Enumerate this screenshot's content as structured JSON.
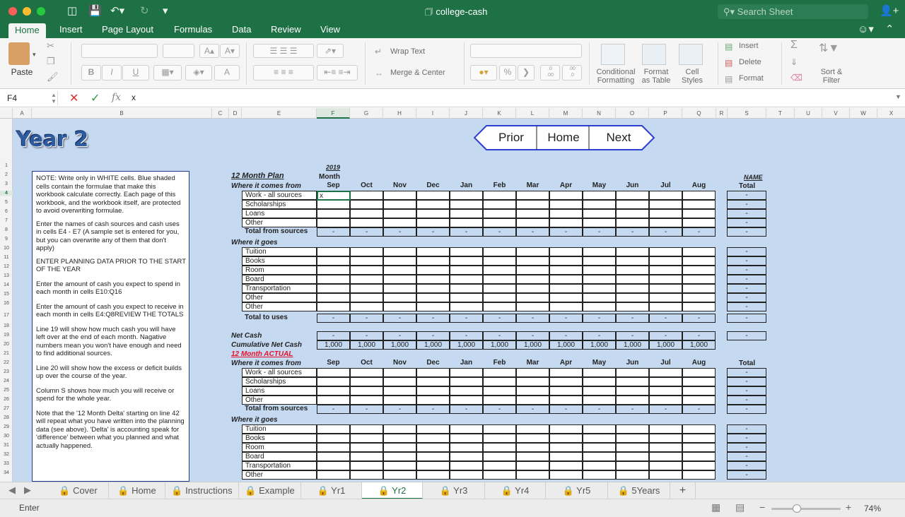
{
  "window": {
    "title": "college-cash",
    "search_placeholder": "Search Sheet"
  },
  "ribbon_tabs": [
    "Home",
    "Insert",
    "Page Layout",
    "Formulas",
    "Data",
    "Review",
    "View"
  ],
  "ribbon": {
    "paste": "Paste",
    "wrap_text": "Wrap Text",
    "merge_center": "Merge & Center",
    "percent": "%",
    "comma": "❯",
    "dec_inc": ".0\n.00",
    "dec_dec": ".00\n→.0",
    "conditional_formatting": "Conditional\nFormatting",
    "format_as_table": "Format\nas Table",
    "cell_styles": "Cell\nStyles",
    "insert": "Insert",
    "delete": "Delete",
    "format": "Format",
    "sort_filter": "Sort &\nFilter",
    "bold": "B",
    "italic": "I",
    "underline": "U",
    "grow_font": "A▴",
    "shrink_font": "A▾",
    "font_color": "A"
  },
  "formula_bar": {
    "name_box": "F4",
    "fx": "fx",
    "value": "x"
  },
  "columns": [
    "A",
    "B",
    "C",
    "D",
    "E",
    "F",
    "G",
    "H",
    "I",
    "J",
    "K",
    "L",
    "M",
    "N",
    "O",
    "P",
    "Q",
    "R",
    "S",
    "T",
    "U",
    "V",
    "W",
    "X"
  ],
  "rows": [
    "1",
    "2",
    "3",
    "4",
    "5",
    "6",
    "7",
    "8",
    "9",
    "10",
    "11",
    "12",
    "13",
    "14",
    "15",
    "16",
    "17",
    "18",
    "19",
    "20",
    "21",
    "22",
    "23",
    "24",
    "25",
    "26",
    "27",
    "28",
    "29",
    "30",
    "31",
    "32",
    "33",
    "34"
  ],
  "sheet": {
    "heading": "Year 2",
    "nav": {
      "prior": "Prior",
      "home": "Home",
      "next": "Next"
    },
    "notes": [
      "NOTE: Write only in WHITE cells. Blue shaded cells contain the formulae that make this workbook calculate correctly. Each page of this workbook, and the workbook itself, are protected to avoid overwriting formulae.",
      "Enter the names of cash sources and cash uses in cells E4 - E7  (A sample set is entered for you, but you can overwrite any of them that don't apply)",
      "ENTER PLANNING DATA PRIOR TO THE START OF THE YEAR",
      "Enter the amount of cash you expect to spend in each month in cells E10:Q16",
      "Enter the amount of cash you expect to receive in each month in cells E4:Q8REVIEW THE TOTALS",
      "Line 19 will show how much cash you will have left over at the end of each month. Nagative numbers mean you won't have enough and need to find additional sources.",
      "Line 20 will show how the excess or deficit builds up over the course of the year.",
      "Column S shows how much you will receive or spend for the whole year.",
      "Note that the '12 Month Delta' starting on line 42 will repeat what you have written into the planning data (see above). 'Delta' is accounting speak for 'difference' between what you planned and what actually happened."
    ],
    "year": "2019",
    "month_label": "Month",
    "plan_title": "12 Month Plan",
    "actual_title": "12 Month ACTUAL",
    "name_label": "NAME",
    "total_label": "Total",
    "months": [
      "Sep",
      "Oct",
      "Nov",
      "Dec",
      "Jan",
      "Feb",
      "Mar",
      "Apr",
      "May",
      "Jun",
      "Jul",
      "Aug"
    ],
    "where_from": "Where it comes from",
    "where_goes": "Where it goes",
    "sources": [
      "Work - all sources",
      "Scholarships",
      "Loans",
      "Other"
    ],
    "uses": [
      "Tuition",
      "Books",
      "Room",
      "Board",
      "Transportation",
      "Other",
      "Other"
    ],
    "uses_actual": [
      "Tuition",
      "Books",
      "Room",
      "Board",
      "Transportation",
      "Other"
    ],
    "total_sources": "Total from sources",
    "total_uses": "Total to uses",
    "net_cash": "Net Cash",
    "cumulative": "Cumulative Net Cash",
    "dash": "-",
    "cumulative_values": [
      "1,000",
      "1,000",
      "1,000",
      "1,000",
      "1,000",
      "1,000",
      "1,000",
      "1,000",
      "1,000",
      "1,000",
      "1,000",
      "1,000"
    ],
    "active_cell_value": "x"
  },
  "sheet_tabs": [
    "Cover",
    "Home",
    "Instructions",
    "Example",
    "Yr1",
    "Yr2",
    "Yr3",
    "Yr4",
    "Yr5",
    "5Years"
  ],
  "active_sheet": "Yr2",
  "status": {
    "mode": "Enter",
    "zoom": "74%"
  },
  "colors": {
    "excel_green": "#1e7145",
    "sheet_blue": "#c5d9f1",
    "heading_blue": "#2e5a9e",
    "actual_red": "#e8102a"
  }
}
